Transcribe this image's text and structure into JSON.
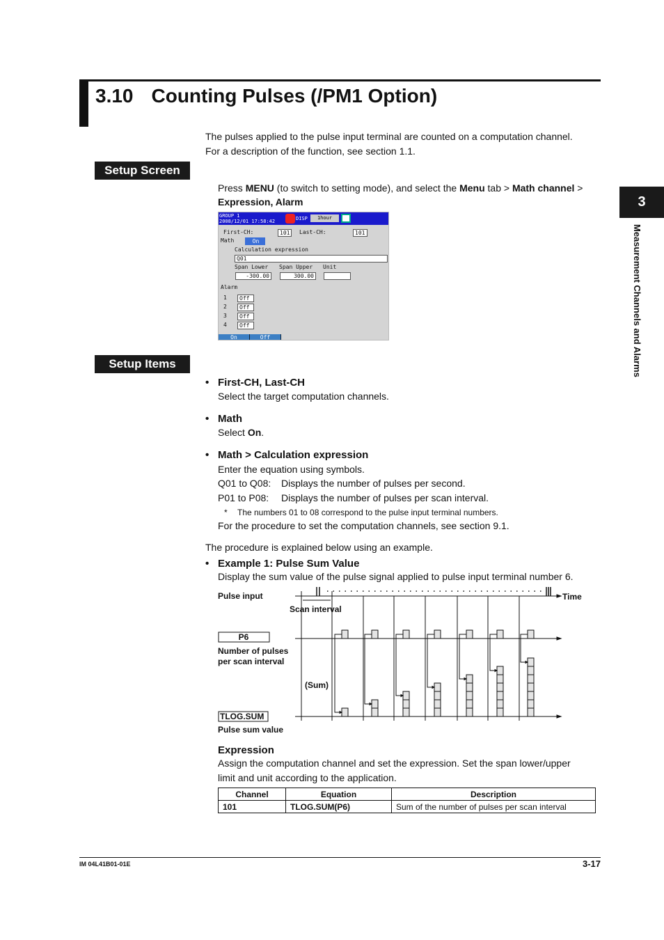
{
  "section": {
    "number": "3.10",
    "title": "Counting Pulses (/PM1 Option)"
  },
  "intro": [
    "The pulses applied to the pulse input terminal are counted on a computation channel.",
    "For a description of the function, see section 1.1."
  ],
  "setup_screen_label": "Setup Screen",
  "press": {
    "t1": "Press ",
    "menu": "MENU",
    "t2": " (to switch to setting mode), and select the ",
    "menu_tab": "Menu",
    "t3": " tab > ",
    "math_ch": "Math channel",
    "t4": " >",
    "line2": "Expression, Alarm"
  },
  "screen": {
    "group": "GROUP 1",
    "datetime": "2008/12/01  17:58:42",
    "disp": "DISP",
    "interval": "1hour",
    "first_ch_label": "First-CH:",
    "first_ch": "101",
    "last_ch_label": "Last-CH:",
    "last_ch": "101",
    "math_label": "Math",
    "math": "On",
    "calc_label": "Calculation expression",
    "calc": "Q01",
    "span_lower_label": "Span Lower",
    "span_lower": "-300.00",
    "span_upper_label": "Span Upper",
    "span_upper": "300.00",
    "unit_label": "Unit",
    "unit": "",
    "alarm_label": "Alarm",
    "alarms": [
      {
        "n": "1",
        "v": "Off"
      },
      {
        "n": "2",
        "v": "Off"
      },
      {
        "n": "3",
        "v": "Off"
      },
      {
        "n": "4",
        "v": "Off"
      }
    ],
    "soft_keys": [
      "On",
      "Off"
    ]
  },
  "setup_items_label": "Setup Items",
  "items": {
    "first_last": {
      "title": "First-CH, Last-CH",
      "desc": "Select the target computation channels."
    },
    "math": {
      "title": "Math",
      "desc1": "Select ",
      "desc_b": "On",
      "desc2": "."
    },
    "calc": {
      "title": "Math > Calculation expression",
      "desc": "Enter the equation using symbols.",
      "q_range": "Q01 to Q08:",
      "q_desc": "Displays the number of pulses per second.",
      "p_range": "P01 to P08:",
      "p_desc": "Displays the number of pulses per scan interval.",
      "note_mark": "*",
      "note": "The numbers 01 to 08 correspond to the pulse input terminal numbers.",
      "ref": "For the procedure to set the computation channels, see section 9.1."
    }
  },
  "procedure": "The procedure is explained below using an example.",
  "example": {
    "title": "Example 1: Pulse Sum Value",
    "desc": "Display the sum value of the pulse signal applied to pulse input terminal number 6."
  },
  "diagram": {
    "pulse_input": "Pulse input",
    "time": "Time",
    "scan_interval": "Scan interval",
    "p6": "P6",
    "p6_desc1": "Number of pulses",
    "p6_desc2": "per scan interval",
    "sum": "(Sum)",
    "tlog": "TLOG.SUM",
    "tlog_desc": "Pulse sum value",
    "pulses_per_interval": [
      1,
      1,
      1,
      1,
      1,
      1,
      1
    ],
    "sums": [
      1,
      2,
      3,
      4,
      5,
      6,
      7
    ]
  },
  "expression": {
    "title": "Expression",
    "desc1": "Assign the computation channel and set the expression. Set the span lower/upper",
    "desc2": "limit and unit according to the application.",
    "headers": [
      "Channel",
      "Equation",
      "Description"
    ],
    "rows": [
      [
        "101",
        "TLOG.SUM(P6)",
        "Sum of the number of pulses per scan interval"
      ]
    ]
  },
  "chapter": {
    "number": "3",
    "title": "Measurement Channels and Alarms"
  },
  "footer": {
    "doc": "IM 04L41B01-01E",
    "page": "3-17"
  }
}
